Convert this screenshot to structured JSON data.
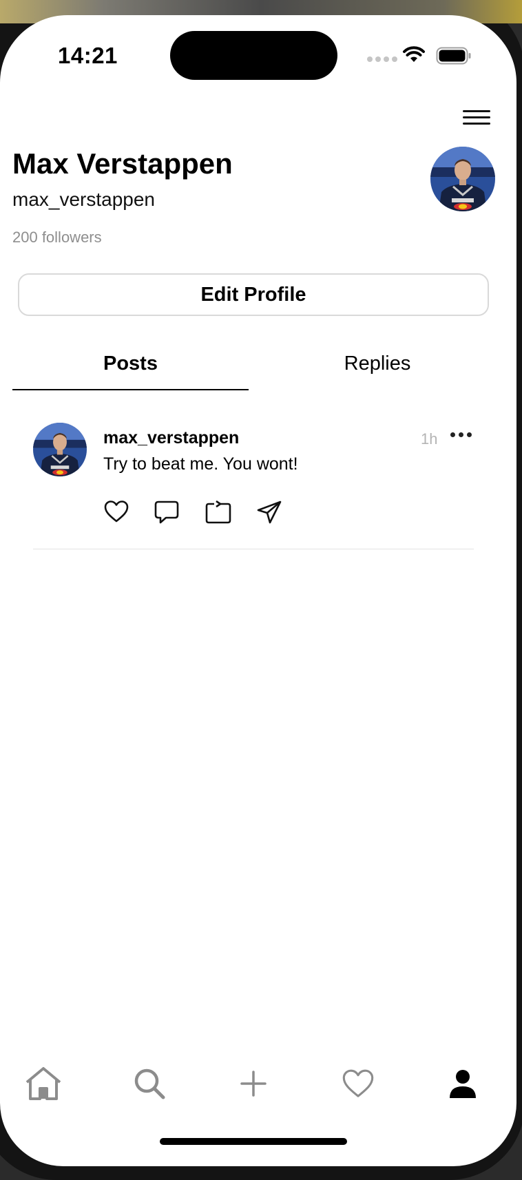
{
  "status_bar": {
    "time": "14:21"
  },
  "profile": {
    "name": "Max Verstappen",
    "handle": "max_verstappen",
    "followers": "200 followers",
    "edit_label": "Edit Profile"
  },
  "tabs": [
    {
      "label": "Posts",
      "selected": true
    },
    {
      "label": "Replies",
      "selected": false
    }
  ],
  "post": {
    "username": "max_verstappen",
    "time": "1h",
    "text": "Try to beat me. You wont!",
    "actions": [
      "heart-icon",
      "comment-icon",
      "repost-icon",
      "share-icon"
    ]
  },
  "bottom_nav": {
    "items": [
      "home-icon",
      "search-icon",
      "add-icon",
      "heart-icon",
      "profile-icon"
    ],
    "active": "profile-icon"
  },
  "colors": {
    "text": "#000000",
    "muted": "#8e8e8e",
    "timestamp": "#b4b4b4",
    "border": "#d9d9d9",
    "inactive_nav": "#8c8c8c",
    "avatar_bg": "#2a4f9a"
  }
}
